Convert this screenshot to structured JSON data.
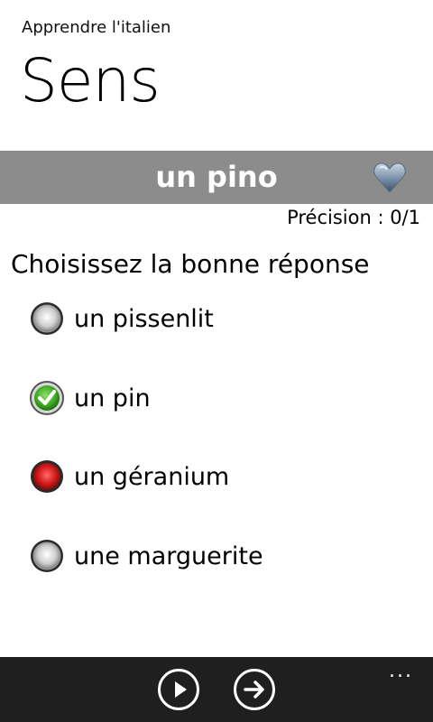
{
  "app": {
    "title": "Apprendre l'italien",
    "page_title": "Sens"
  },
  "word_band": {
    "word": "un pino",
    "favorite_icon": "heart-icon",
    "band_color": "#8c8c8c"
  },
  "precision": {
    "text": "Précision : 0/1"
  },
  "quiz": {
    "prompt": "Choisissez la bonne réponse",
    "options": [
      {
        "label": "un pissenlit",
        "state": "neutral",
        "icon": "gray-radio-icon"
      },
      {
        "label": "un pin",
        "state": "correct",
        "icon": "green-check-icon"
      },
      {
        "label": "un géranium",
        "state": "wrong",
        "icon": "red-radio-icon"
      },
      {
        "label": "une marguerite",
        "state": "neutral",
        "icon": "gray-radio-icon"
      }
    ]
  },
  "app_bar": {
    "buttons": [
      {
        "icon": "play-icon"
      },
      {
        "icon": "next-arrow-icon"
      }
    ],
    "more": "...",
    "background": "#1f1f1f"
  }
}
